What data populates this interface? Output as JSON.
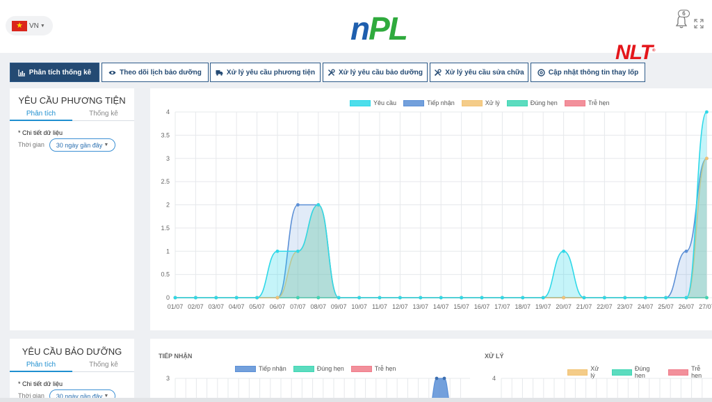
{
  "header": {
    "language": "VN",
    "logo_n": "n",
    "logo_pl": "PL",
    "notification_count": "6",
    "brand_logo": "NLT",
    "brand_reg": "®"
  },
  "tabs": [
    {
      "label": "Phân tích thống kê",
      "icon": "bar-chart-icon",
      "active": true
    },
    {
      "label": "Theo dõi lịch bảo dưỡng",
      "icon": "eye-icon",
      "active": false
    },
    {
      "label": "Xử lý yêu cầu phương tiện",
      "icon": "truck-icon",
      "active": false
    },
    {
      "label": "Xử lý yêu cầu bảo dưỡng",
      "icon": "tools-icon",
      "active": false
    },
    {
      "label": "Xử lý yêu cầu sửa chữa",
      "icon": "tools-icon",
      "active": false
    },
    {
      "label": "Cập nhật thông tin thay lốp",
      "icon": "tire-icon",
      "active": false
    }
  ],
  "vehicle_panel": {
    "title": "YÊU CẦU PHƯƠNG TIỆN",
    "subtab_analysis": "Phân tích",
    "subtab_stats": "Thống kê",
    "detail_label": "* Chi tiết dữ liệu",
    "time_label": "Thời gian",
    "time_value": "30 ngày gần đây"
  },
  "maintenance_panel": {
    "title": "YÊU CẦU BẢO DƯỠNG",
    "subtab_analysis": "Phân tích",
    "subtab_stats": "Thống kê",
    "detail_label": "* Chi tiết dữ liệu",
    "time_label": "Thời gian",
    "time_value": "30 ngày gần đây"
  },
  "received_chart": {
    "title": "TIẾP NHẬN",
    "legend": [
      "Tiếp nhận",
      "Đúng hẹn",
      "Trễ hẹn"
    ],
    "y_top": "3"
  },
  "processed_chart": {
    "title": "XỬ LÝ",
    "legend": [
      "Xử lý",
      "Đúng hẹn",
      "Trễ hẹn"
    ],
    "y_top": "4"
  },
  "colors": {
    "requests": "#2ed8e8",
    "received": "#5b8fd6",
    "processed": "#f2c374",
    "on_time": "#3fd6b4",
    "late": "#f07c8a",
    "nav": "#244a73"
  },
  "chart_data": {
    "type": "area",
    "x": [
      "01/07",
      "02/07",
      "03/07",
      "04/07",
      "05/07",
      "06/07",
      "07/07",
      "08/07",
      "09/07",
      "10/07",
      "11/07",
      "12/07",
      "13/07",
      "14/07",
      "15/07",
      "16/07",
      "17/07",
      "18/07",
      "19/07",
      "20/07",
      "21/07",
      "22/07",
      "23/07",
      "24/07",
      "25/07",
      "26/07",
      "27/07"
    ],
    "ylim": [
      0,
      4
    ],
    "yticks": [
      "0",
      "0.5",
      "1",
      "1.5",
      "2",
      "2.5",
      "3",
      "3.5",
      "4"
    ],
    "grid": true,
    "legend_position": "top-center",
    "series": [
      {
        "name": "Yêu cầu",
        "values": [
          0,
          0,
          0,
          0,
          0,
          1,
          1,
          2,
          0,
          0,
          0,
          0,
          0,
          0,
          0,
          0,
          0,
          0,
          0,
          1,
          0,
          0,
          0,
          0,
          0,
          0,
          4
        ]
      },
      {
        "name": "Tiếp nhận",
        "values": [
          0,
          0,
          0,
          0,
          0,
          0,
          2,
          2,
          0,
          0,
          0,
          0,
          0,
          0,
          0,
          0,
          0,
          0,
          0,
          0,
          0,
          0,
          0,
          0,
          0,
          1,
          3
        ]
      },
      {
        "name": "Xử lý",
        "values": [
          0,
          0,
          0,
          0,
          0,
          0,
          1,
          2,
          0,
          0,
          0,
          0,
          0,
          0,
          0,
          0,
          0,
          0,
          0,
          0,
          0,
          0,
          0,
          0,
          0,
          0,
          3
        ]
      },
      {
        "name": "Đúng hẹn",
        "values": [
          0,
          0,
          0,
          0,
          0,
          0,
          0,
          0,
          0,
          0,
          0,
          0,
          0,
          0,
          0,
          0,
          0,
          0,
          0,
          0,
          0,
          0,
          0,
          0,
          0,
          0,
          0
        ]
      },
      {
        "name": "Trễ hẹn",
        "values": [
          0,
          0,
          0,
          0,
          0,
          0,
          0,
          0,
          0,
          0,
          0,
          0,
          0,
          0,
          0,
          0,
          0,
          0,
          0,
          0,
          0,
          0,
          0,
          0,
          0,
          0,
          0
        ]
      }
    ]
  }
}
